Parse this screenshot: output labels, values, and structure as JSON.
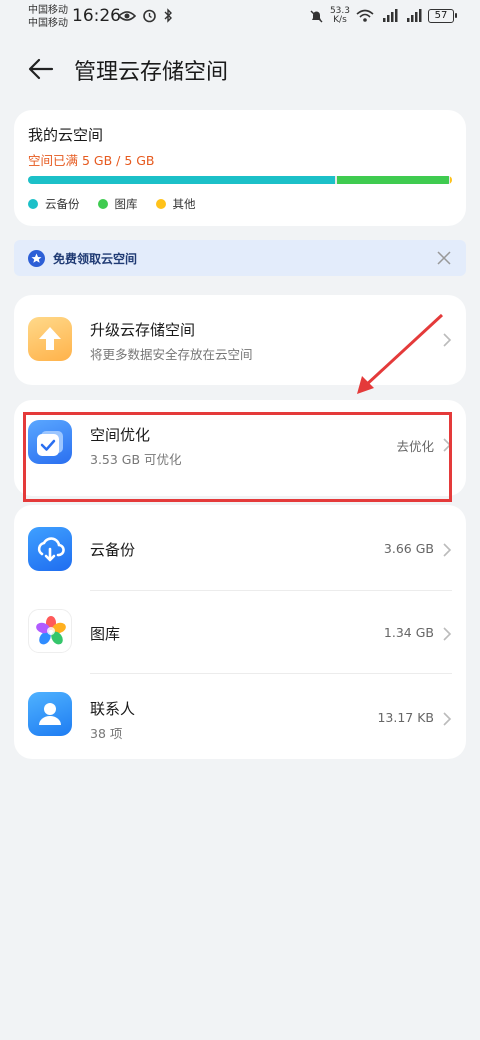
{
  "status_bar": {
    "carrier_1": "中国移动",
    "carrier_2": "中国移动",
    "time": "16:26",
    "net_speed_value": "53.3",
    "net_speed_unit": "K/s",
    "battery": "57"
  },
  "header": {
    "title": "管理云存储空间"
  },
  "storage": {
    "title": "我的云空间",
    "used_text": "空间已满 5 GB / 5 GB",
    "usage_segments": [
      {
        "name": "云备份",
        "fraction": 0.732,
        "color": "#1cc0c8"
      },
      {
        "name": "图库",
        "fraction": 0.268,
        "color": "#3fcb50"
      },
      {
        "name": "其他",
        "fraction": 0.005,
        "color": "#ffc21a"
      }
    ],
    "legend": [
      "云备份",
      "图库",
      "其他"
    ]
  },
  "promo": {
    "text": "免费领取云空间"
  },
  "upgrade": {
    "title": "升级云存储空间",
    "subtitle": "将更多数据安全存放在云空间"
  },
  "optimize": {
    "title": "空间优化",
    "subtitle": "3.53 GB 可优化",
    "action": "去优化"
  },
  "apps": [
    {
      "name": "云备份",
      "value": "3.66 GB",
      "subtitle": ""
    },
    {
      "name": "图库",
      "value": "1.34 GB",
      "subtitle": ""
    },
    {
      "name": "联系人",
      "value": "13.17 KB",
      "subtitle": "38 项"
    }
  ],
  "colors": {
    "accent_orange": "#e65a1f",
    "annotation_red": "#e43a3a"
  }
}
